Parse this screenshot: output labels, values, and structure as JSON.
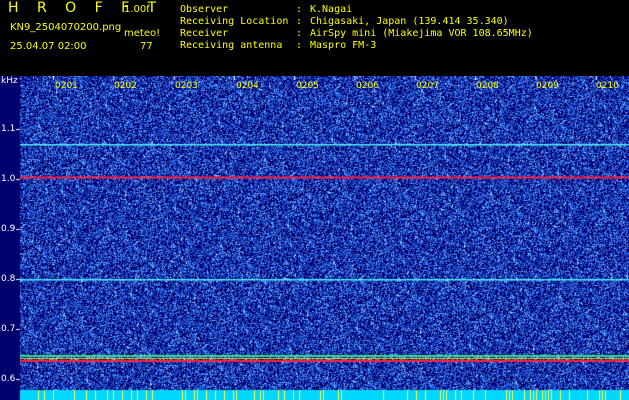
{
  "header": {
    "title": "H R O F F T",
    "version": "1.00f",
    "filename": "KN9_2504070200.png",
    "timestamp": "25.04.07 02:00",
    "meteo_label": "meteo!",
    "count": "77"
  },
  "info": [
    {
      "key": "Observer",
      "value": "K.Nagai"
    },
    {
      "key": "Receiving Location",
      "value": "Chigasaki, Japan (139.414 35.340)"
    },
    {
      "key": "Receiver",
      "value": "AirSpy mini (Miakejima VOR 108.65MHz)"
    },
    {
      "key": "Receiving antenna",
      "value": "Maspro FM-3"
    }
  ],
  "separator": ":",
  "y_unit": "kHz",
  "y_ticks": [
    "1.1",
    "1.0",
    "0.9",
    "0.8",
    "0.7",
    "0.6"
  ],
  "x_ticks": [
    "0201",
    "0202",
    "0203",
    "0204",
    "0205",
    "0206",
    "0207",
    "0208",
    "0209",
    "0210"
  ],
  "colors": {
    "background": "#00006e",
    "noise": "#3c7cff",
    "line_cyan": "#4ff0ff",
    "line_red": "#ff2040",
    "text_yellow": "#ffff00",
    "footer_cyan": "#00d8ff"
  },
  "spectrum_lines": [
    {
      "freq_khz": 1.07,
      "color": "line_cyan"
    },
    {
      "freq_khz": 1.005,
      "color": "line_red"
    },
    {
      "freq_khz": 0.8,
      "color": "line_cyan"
    },
    {
      "freq_khz": 0.638,
      "color": "line_red"
    }
  ]
}
